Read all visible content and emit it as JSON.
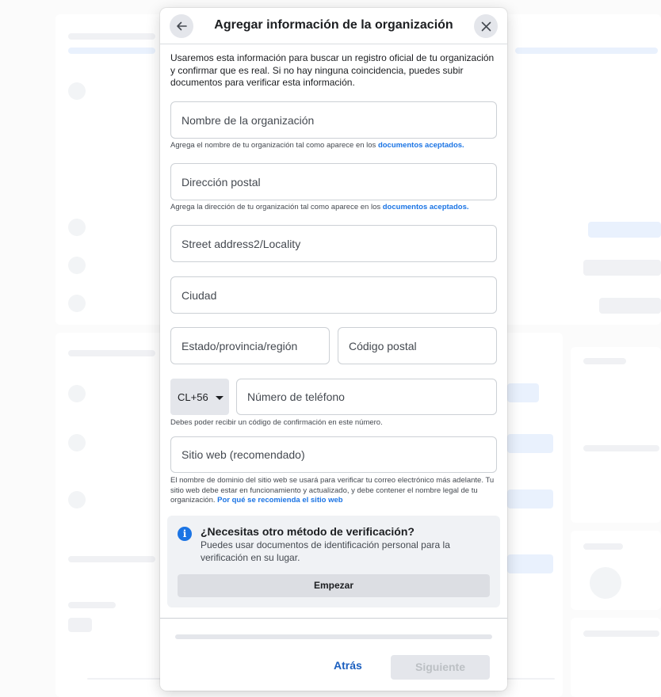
{
  "modal": {
    "title": "Agregar información de la organización",
    "intro": "Usaremos esta información para buscar un registro oficial de tu organización y confirmar que es real. Si no hay ninguna coincidencia, puedes subir documentos para verificar esta información."
  },
  "form": {
    "org_name": {
      "placeholder": "Nombre de la organización",
      "value": ""
    },
    "org_name_help": "Agrega el nombre de tu organización tal como aparece en los ",
    "org_name_help_link": "documentos aceptados.",
    "address": {
      "placeholder": "Dirección postal",
      "value": ""
    },
    "address_help": "Agrega la dirección de tu organización tal como aparece en los ",
    "address_help_link": "documentos aceptados.",
    "address2": {
      "placeholder": "Street address2/Locality",
      "value": ""
    },
    "city": {
      "placeholder": "Ciudad",
      "value": ""
    },
    "state": {
      "placeholder": "Estado/provincia/región",
      "value": ""
    },
    "postal": {
      "placeholder": "Código postal",
      "value": ""
    },
    "country_code": "CL+56",
    "phone": {
      "placeholder": "Número de teléfono",
      "value": ""
    },
    "phone_help": "Debes poder recibir un código de confirmación en este número.",
    "website": {
      "placeholder": "Sitio web (recomendado)",
      "value": ""
    },
    "website_help": "El nombre de dominio del sitio web se usará para verificar tu correo electrónico más adelante. Tu sitio web debe estar en funcionamiento y actualizado, y debe contener el nombre legal de tu organización. ",
    "website_help_link": "Por qué se recomienda el sitio web"
  },
  "alt_method": {
    "icon": "info-icon",
    "title": "¿Necesitas otro método de verificación?",
    "description": "Puedes usar documentos de identificación personal para la verificación en su lugar.",
    "button": "Empezar"
  },
  "progress": {
    "fraction": 0.0
  },
  "footer": {
    "back": "Atrás",
    "next": "Siguiente"
  },
  "colors": {
    "accent": "#1b74e4",
    "link": "#1b5fbf",
    "disabled": "#bcc0c4"
  }
}
